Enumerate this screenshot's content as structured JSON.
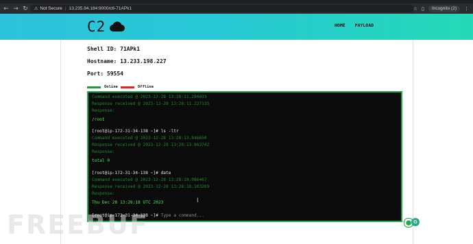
{
  "browser": {
    "security_label": "Not Secure",
    "url": "13.235.94.184:9000/c6-71APk1",
    "profile_label": "Incognito (2)"
  },
  "header": {
    "logo_text": "C2",
    "nav": [
      "HOME",
      "PAYLOAD"
    ]
  },
  "shell": {
    "shell_id": "Shell ID: 71APk1",
    "hostname": "Hostname: 13.233.198.227",
    "port": "Port: 59554"
  },
  "legend": {
    "online_label": "Online",
    "offline_label": "Offline",
    "online_color": "#1e9b36",
    "offline_color": "#e02424"
  },
  "terminal": {
    "lines": [
      {
        "text": "Command executed @ 2023-12-28 13:28:11.286033",
        "kind": "meta"
      },
      {
        "text": "Response received @ 2023-12-28 13:28:11.237135",
        "kind": "meta"
      },
      {
        "text": "Response:",
        "kind": "meta"
      },
      {
        "text": "/root",
        "kind": "out"
      },
      {
        "text": "[root@ip-172-31-34-138 ~]# ls -ltr",
        "kind": "prompt"
      },
      {
        "text": "Command executed @ 2023-12-28 13:28:13.846650",
        "kind": "meta"
      },
      {
        "text": "Response received @ 2023-12-28 13:28:13.863742",
        "kind": "meta"
      },
      {
        "text": "Response:",
        "kind": "meta"
      },
      {
        "text": "total 0",
        "kind": "out"
      },
      {
        "text": "[root@ip-172-31-34-138 ~]# date",
        "kind": "prompt"
      },
      {
        "text": "Command executed @ 2023-12-28 13:28:18.086467",
        "kind": "meta"
      },
      {
        "text": "Response received @ 2023-12-28 13:28:18.103209",
        "kind": "meta"
      },
      {
        "text": "Response:",
        "kind": "meta"
      },
      {
        "text": "Thu Dec 28 13:28:18 UTC 2023",
        "kind": "out"
      }
    ],
    "prompt_label": "[root@ip-172-31-34-138 ~]#",
    "input_placeholder": "Type a command..."
  },
  "watermark": "FREEBUF"
}
